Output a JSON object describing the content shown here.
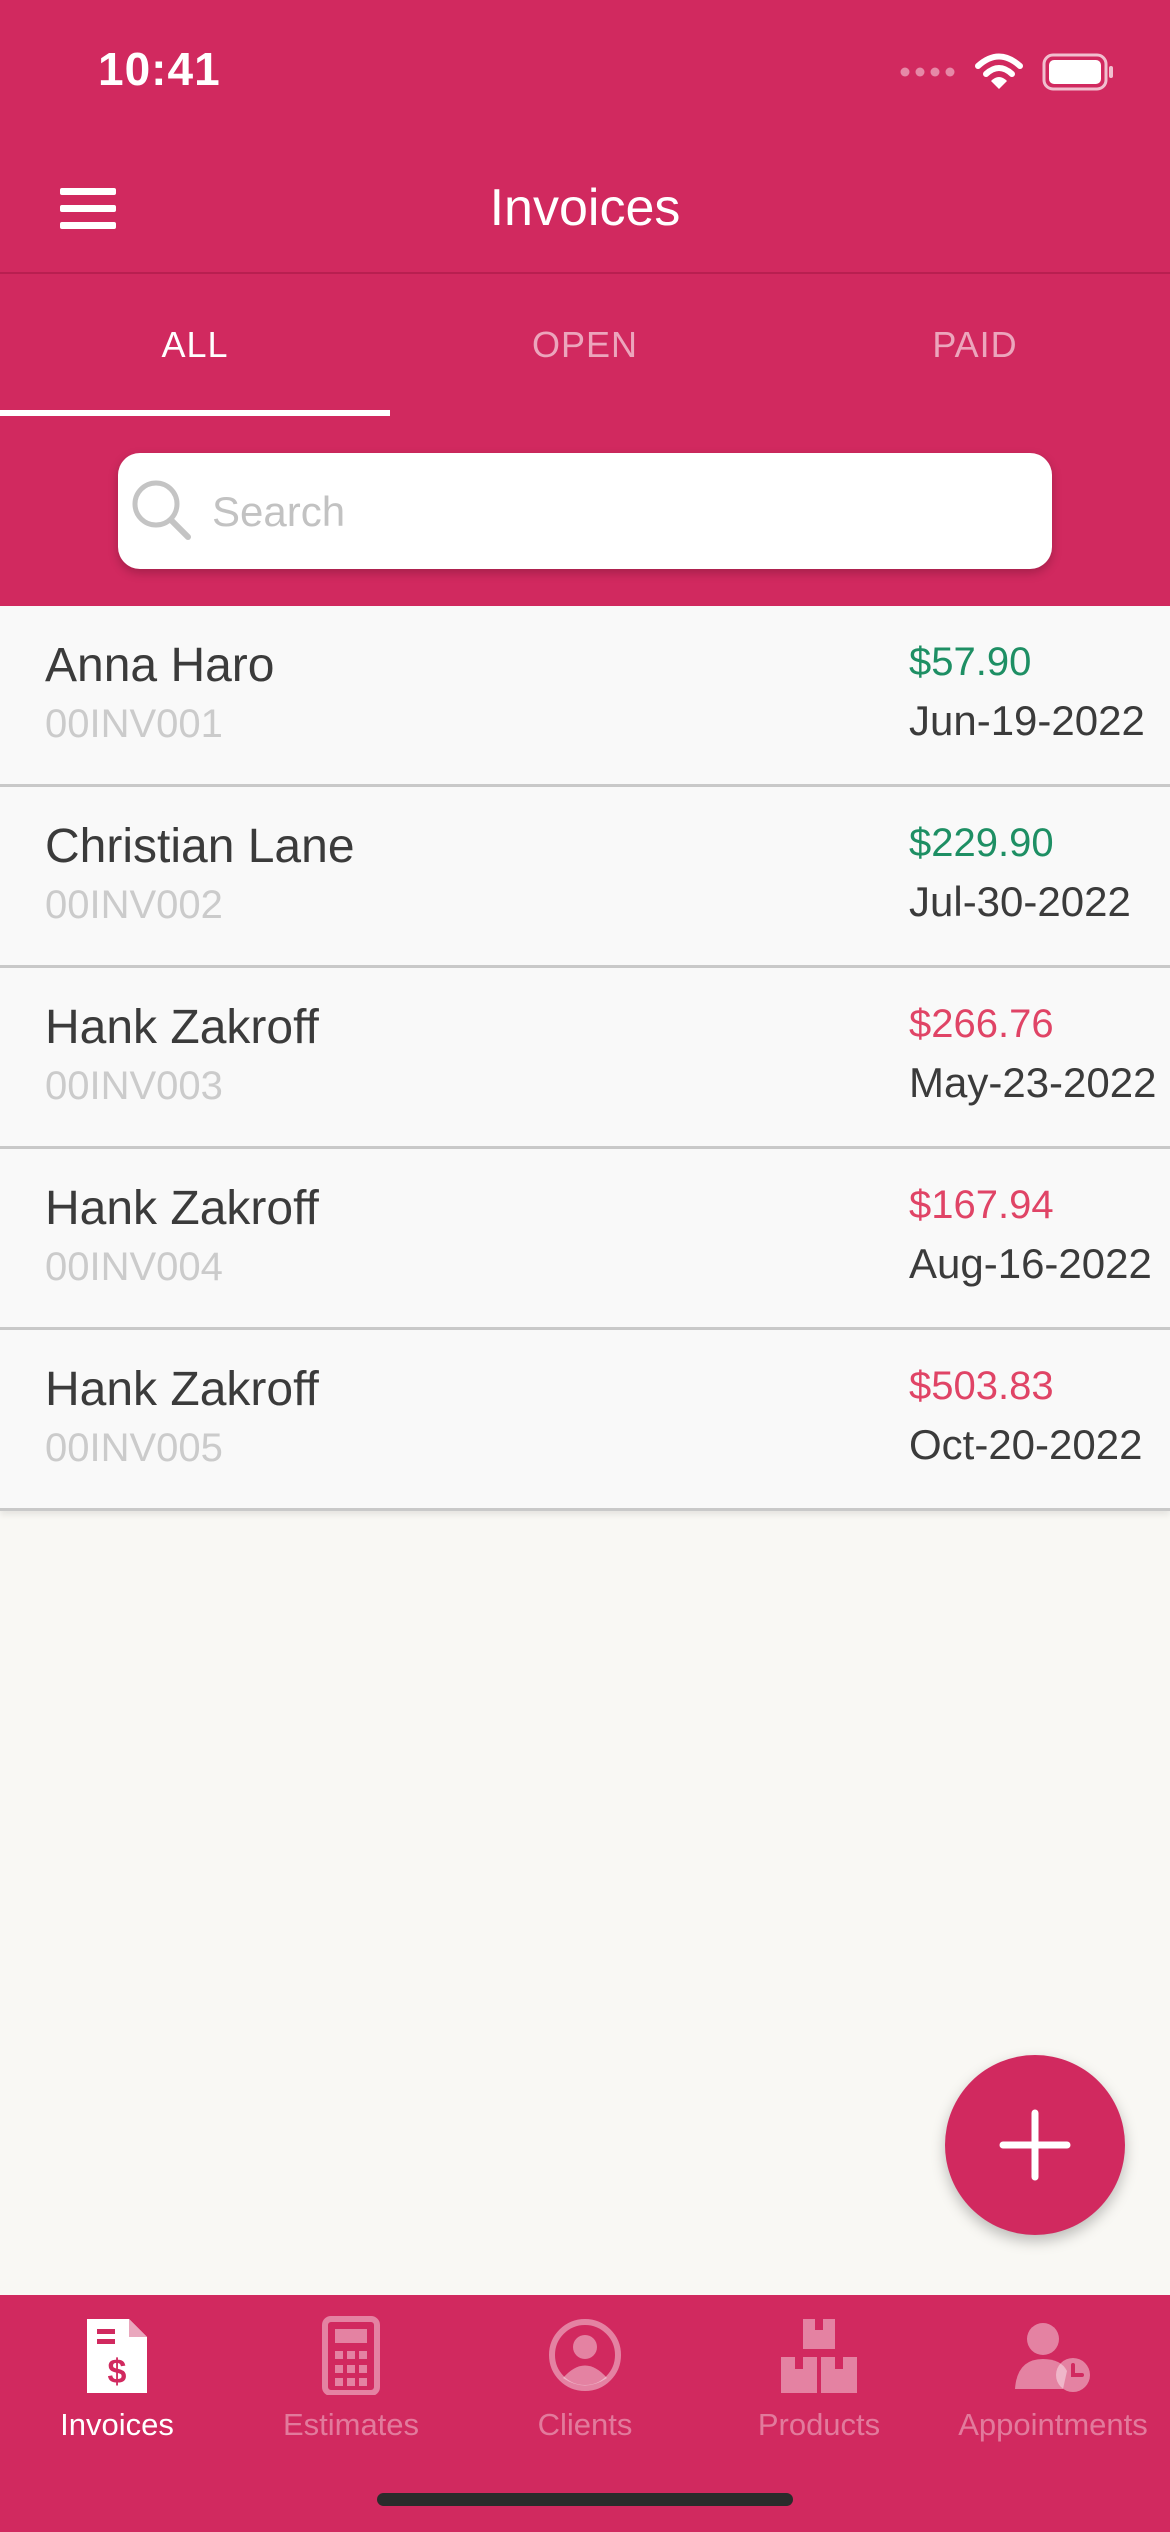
{
  "status_bar": {
    "time": "10:41"
  },
  "header": {
    "title": "Invoices"
  },
  "tabs": [
    {
      "label": "ALL",
      "active": true
    },
    {
      "label": "OPEN",
      "active": false
    },
    {
      "label": "PAID",
      "active": false
    }
  ],
  "search": {
    "placeholder": "Search",
    "value": ""
  },
  "invoices": [
    {
      "client": "Anna Haro",
      "number": "00INV001",
      "amount": "$57.90",
      "date": "Jun-19-2022",
      "status": "paid"
    },
    {
      "client": "Christian Lane",
      "number": "00INV002",
      "amount": "$229.90",
      "date": "Jul-30-2022",
      "status": "paid"
    },
    {
      "client": "Hank Zakroff",
      "number": "00INV003",
      "amount": "$266.76",
      "date": "May-23-2022",
      "status": "open"
    },
    {
      "client": "Hank Zakroff",
      "number": "00INV004",
      "amount": "$167.94",
      "date": "Aug-16-2022",
      "status": "open"
    },
    {
      "client": "Hank Zakroff",
      "number": "00INV005",
      "amount": "$503.83",
      "date": "Oct-20-2022",
      "status": "open"
    }
  ],
  "bottom_nav": [
    {
      "label": "Invoices",
      "icon": "invoice-icon",
      "active": true
    },
    {
      "label": "Estimates",
      "icon": "calculator-icon",
      "active": false
    },
    {
      "label": "Clients",
      "icon": "client-icon",
      "active": false
    },
    {
      "label": "Products",
      "icon": "boxes-icon",
      "active": false
    },
    {
      "label": "Appointments",
      "icon": "appointment-icon",
      "active": false
    }
  ],
  "colors": {
    "brand": "#d1295f",
    "paid_amount": "#1e8f64",
    "open_amount": "#e04466",
    "background": "#f9f8f4"
  }
}
